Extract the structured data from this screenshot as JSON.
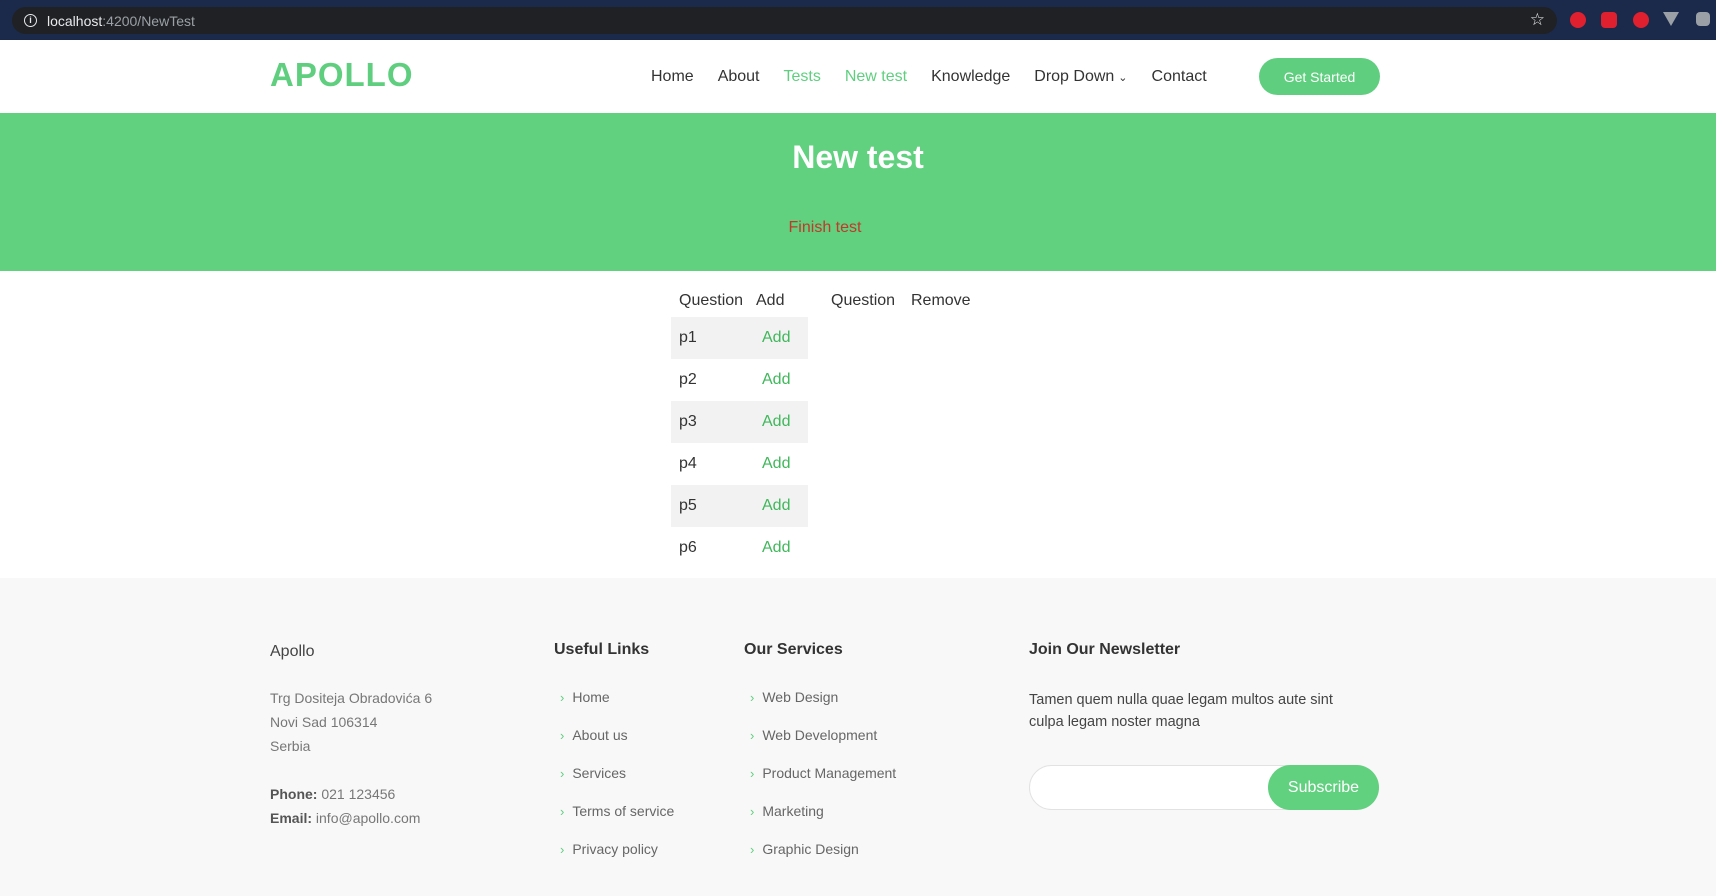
{
  "browser": {
    "url_host": "localhost",
    "url_path": ":4200/NewTest",
    "info_icon": "info-icon",
    "star_icon": "star-icon"
  },
  "header": {
    "logo": "APOLLO",
    "nav": [
      {
        "label": "Home",
        "active": false
      },
      {
        "label": "About",
        "active": false
      },
      {
        "label": "Tests",
        "active": true
      },
      {
        "label": "New test",
        "active": true
      },
      {
        "label": "Knowledge",
        "active": false
      },
      {
        "label": "Drop Down",
        "active": false,
        "dropdown": true
      },
      {
        "label": "Contact",
        "active": false
      }
    ],
    "cta": "Get Started",
    "accent": "#5fcf7f"
  },
  "hero": {
    "title": "New test",
    "finish_link": "Finish test"
  },
  "available_table": {
    "headers": [
      "Question",
      "Add"
    ],
    "rows": [
      {
        "question": "p1",
        "action": "Add"
      },
      {
        "question": "p2",
        "action": "Add"
      },
      {
        "question": "p3",
        "action": "Add"
      },
      {
        "question": "p4",
        "action": "Add"
      },
      {
        "question": "p5",
        "action": "Add"
      },
      {
        "question": "p6",
        "action": "Add"
      }
    ]
  },
  "selected_table": {
    "headers": [
      "Question",
      "Remove"
    ],
    "rows": []
  },
  "footer": {
    "brand": "Apollo",
    "address_lines": [
      "Trg Dositeja Obradovića 6",
      "Novi Sad 106314",
      "Serbia"
    ],
    "phone_label": "Phone:",
    "phone": "021 123456",
    "email_label": "Email:",
    "email": "info@apollo.com",
    "useful_links_heading": "Useful Links",
    "useful_links": [
      "Home",
      "About us",
      "Services",
      "Terms of service",
      "Privacy policy"
    ],
    "services_heading": "Our Services",
    "services": [
      "Web Design",
      "Web Development",
      "Product Management",
      "Marketing",
      "Graphic Design"
    ],
    "newsletter_heading": "Join Our Newsletter",
    "newsletter_text": "Tamen quem nulla quae legam multos aute sint culpa legam noster magna",
    "newsletter_placeholder": "",
    "subscribe_label": "Subscribe"
  }
}
